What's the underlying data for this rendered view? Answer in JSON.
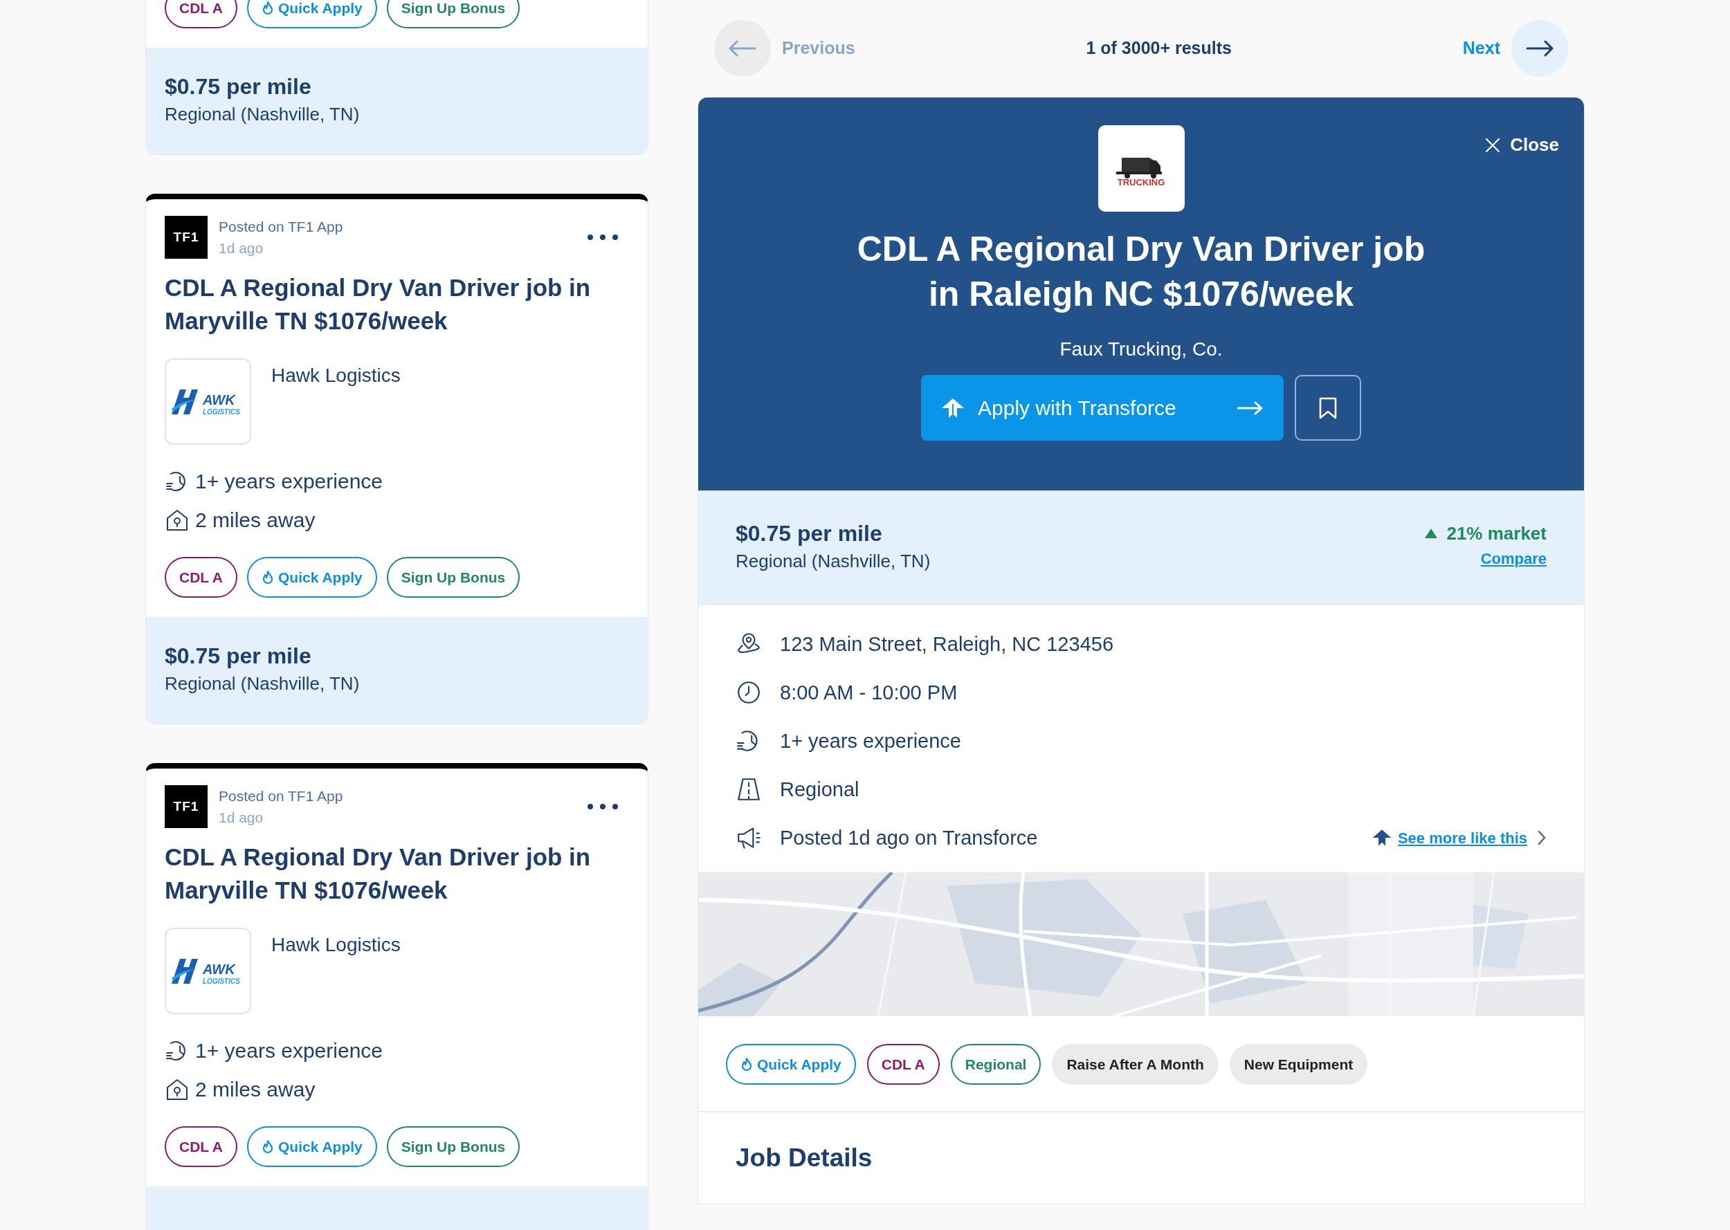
{
  "job_list": [
    {
      "tags": [
        {
          "label": "CDL A",
          "kind": "outline",
          "color": "#8c1d6b"
        },
        {
          "label": "Quick Apply",
          "kind": "quick",
          "color": "#0b8fe0"
        },
        {
          "label": "Sign Up Bonus",
          "kind": "outline",
          "color": "#1f8a5b"
        }
      ],
      "pay": {
        "rate": "$0.75 per mile",
        "route": "Regional (Nashville, TN)"
      }
    },
    {
      "source_logo": "TF1",
      "source": "Posted on TF1 App",
      "age": "1d ago",
      "title": "CDL A Regional Dry Van Driver job in Maryville TN $1076/week",
      "company_logo": {
        "text": "AWK",
        "subtext": "LOGISTICS"
      },
      "company": "Hawk Logistics",
      "facts": [
        {
          "kind": "experience",
          "text": "1+ years experience"
        },
        {
          "kind": "distance",
          "text": "2 miles away"
        }
      ],
      "tags": [
        {
          "label": "CDL A",
          "kind": "outline",
          "color": "#8c1d6b"
        },
        {
          "label": "Quick Apply",
          "kind": "quick",
          "color": "#0b8fe0"
        },
        {
          "label": "Sign Up Bonus",
          "kind": "outline",
          "color": "#1f8a5b"
        }
      ],
      "pay": {
        "rate": "$0.75 per mile",
        "route": "Regional (Nashville, TN)"
      }
    },
    {
      "source_logo": "TF1",
      "source": "Posted on TF1 App",
      "age": "1d ago",
      "title": "CDL A Regional Dry Van Driver job in Maryville TN $1076/week",
      "company_logo": {
        "text": "AWK",
        "subtext": "LOGISTICS"
      },
      "company": "Hawk Logistics",
      "facts": [
        {
          "kind": "experience",
          "text": "1+ years experience"
        },
        {
          "kind": "distance",
          "text": "2 miles away"
        }
      ],
      "tags": [
        {
          "label": "CDL A",
          "kind": "outline",
          "color": "#8c1d6b"
        },
        {
          "label": "Quick Apply",
          "kind": "quick",
          "color": "#0b8fe0"
        },
        {
          "label": "Sign Up Bonus",
          "kind": "outline",
          "color": "#1f8a5b"
        }
      ]
    }
  ],
  "pager": {
    "previous": {
      "label": "Previous",
      "disabled": true
    },
    "count": "1 of 3000+ results",
    "next": {
      "label": "Next",
      "disabled": false
    }
  },
  "job": {
    "logo_text": "TRUCKING",
    "close": "Close",
    "title": "CDL A Regional Dry Van Driver job in Raleigh NC $1076/week",
    "company": "Faux Trucking, Co.",
    "apply": "Apply with Transforce",
    "saved": false,
    "pay": {
      "rate": "$0.75 per mile",
      "route": "Regional (Nashville, TN)",
      "market": "21% market",
      "rising": true,
      "compare": "Compare"
    },
    "details": [
      {
        "kind": "address",
        "text": "123 Main Street, Raleigh, NC 123456"
      },
      {
        "kind": "hours",
        "text": "8:00 AM - 10:00 PM"
      },
      {
        "kind": "experience",
        "text": "1+ years experience"
      },
      {
        "kind": "route",
        "text": "Regional"
      },
      {
        "kind": "posted",
        "text": "Posted 1d ago on Transforce",
        "link": "See more like this"
      }
    ],
    "tags": [
      {
        "label": "Quick Apply",
        "kind": "quick",
        "color": "#0b8fe0"
      },
      {
        "label": "CDL A",
        "kind": "outline",
        "color": "#8c1d6b"
      },
      {
        "label": "Regional",
        "kind": "outline",
        "color": "#1f8a5b"
      },
      {
        "label": "Raise After A Month",
        "kind": "filled",
        "color": "#ebebeb"
      },
      {
        "label": "New Equipment",
        "kind": "filled",
        "color": "#ebebeb"
      }
    ],
    "section": "Job Details"
  }
}
